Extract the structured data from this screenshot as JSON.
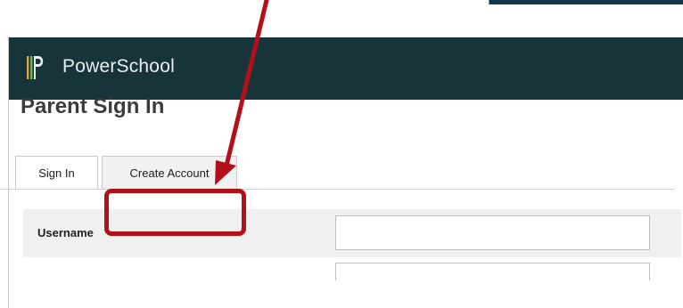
{
  "header": {
    "brand": "PowerSchool"
  },
  "page": {
    "title": "Parent Sign In"
  },
  "tabs": [
    {
      "label": "Sign In",
      "active": true
    },
    {
      "label": "Create Account",
      "active": false,
      "highlighted": true
    }
  ],
  "form": {
    "fields": [
      {
        "label": "Username",
        "value": ""
      }
    ]
  },
  "colors": {
    "header_background": "#17343a",
    "annotation_red": "#b3101a"
  }
}
